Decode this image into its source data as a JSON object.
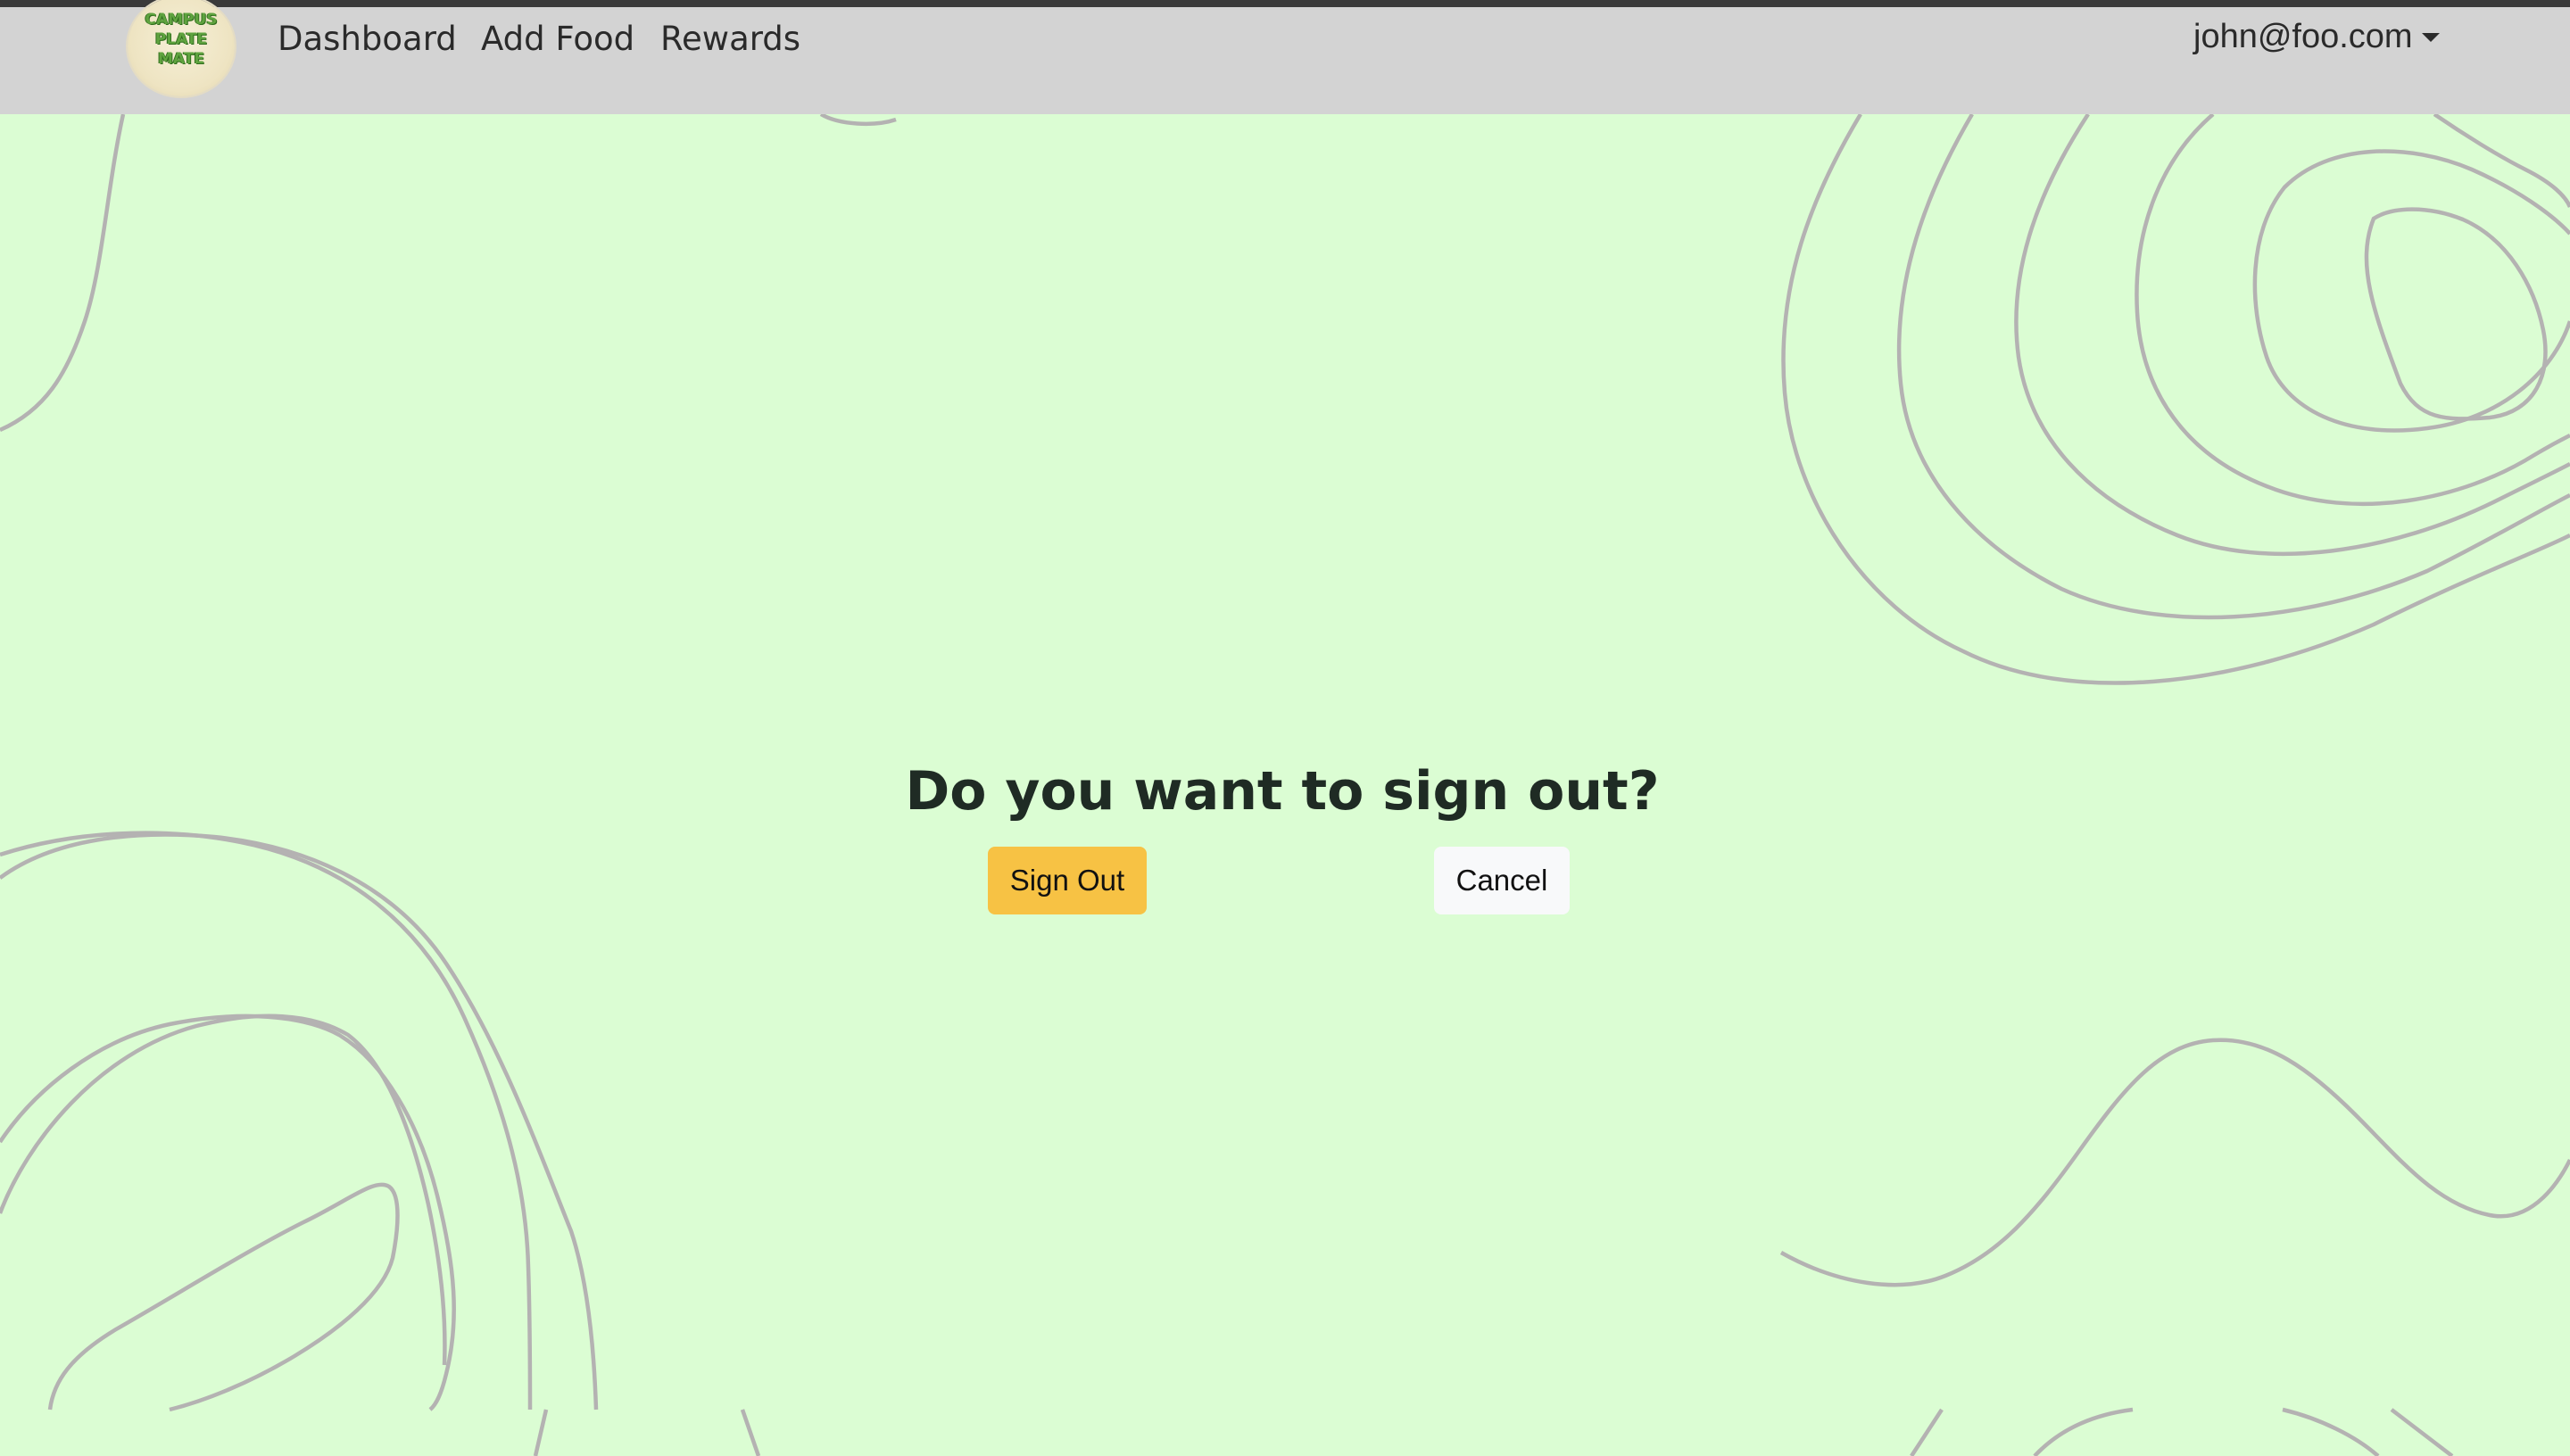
{
  "navbar": {
    "logo_lines": [
      "CAMPUS",
      "PLATE",
      "MATE"
    ],
    "links": [
      {
        "label": "Dashboard"
      },
      {
        "label": "Add Food"
      },
      {
        "label": "Rewards"
      }
    ],
    "user_email": "john@foo.com"
  },
  "main": {
    "title": "Do you want to sign out?",
    "signout_label": "Sign Out",
    "cancel_label": "Cancel"
  },
  "colors": {
    "background": "#dbfdd3",
    "navbar": "#d3d3d3",
    "signout_button": "#f7c244",
    "cancel_button": "#f8f9fa",
    "contour_lines": "#b4b2b2"
  }
}
